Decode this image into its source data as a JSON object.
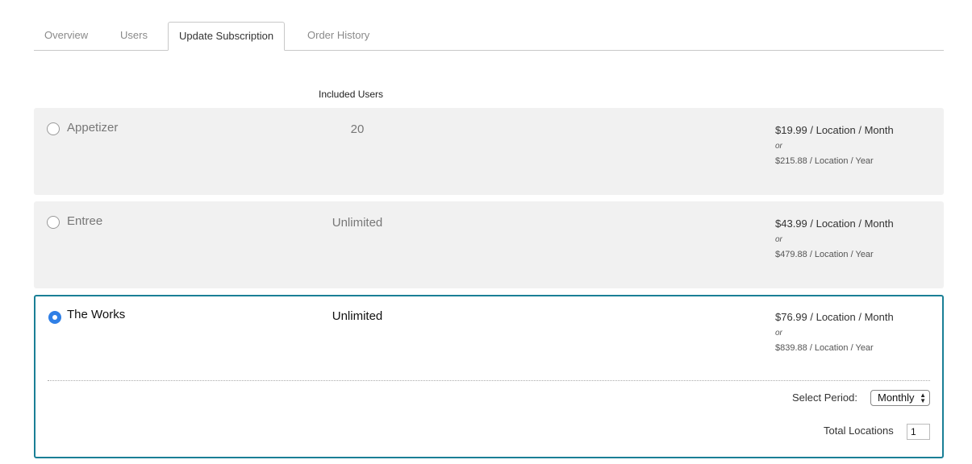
{
  "tabs": [
    "Overview",
    "Users",
    "Update Subscription",
    "Order History"
  ],
  "active_tab": "Update Subscription",
  "table": {
    "users_header": "Included Users"
  },
  "plans": [
    {
      "name": "Appetizer",
      "users": "20",
      "monthly": "$19.99 / Location / Month",
      "or": "or",
      "yearly": "$215.88 / Location / Year",
      "selected": false
    },
    {
      "name": "Entree",
      "users": "Unlimited",
      "monthly": "$43.99 / Location / Month",
      "or": "or",
      "yearly": "$479.88 / Location / Year",
      "selected": false
    },
    {
      "name": "The Works",
      "users": "Unlimited",
      "monthly": "$76.99 / Location / Month",
      "or": "or",
      "yearly": "$839.88 / Location / Year",
      "selected": true
    }
  ],
  "options": {
    "period_label": "Select Period:",
    "period_value": "Monthly",
    "locations_label": "Total Locations",
    "locations_value": "1"
  },
  "colors": {
    "selected_border": "#1a7f96",
    "radio_checked": "#2f7fe6",
    "row_bg": "#f1f1f1"
  }
}
